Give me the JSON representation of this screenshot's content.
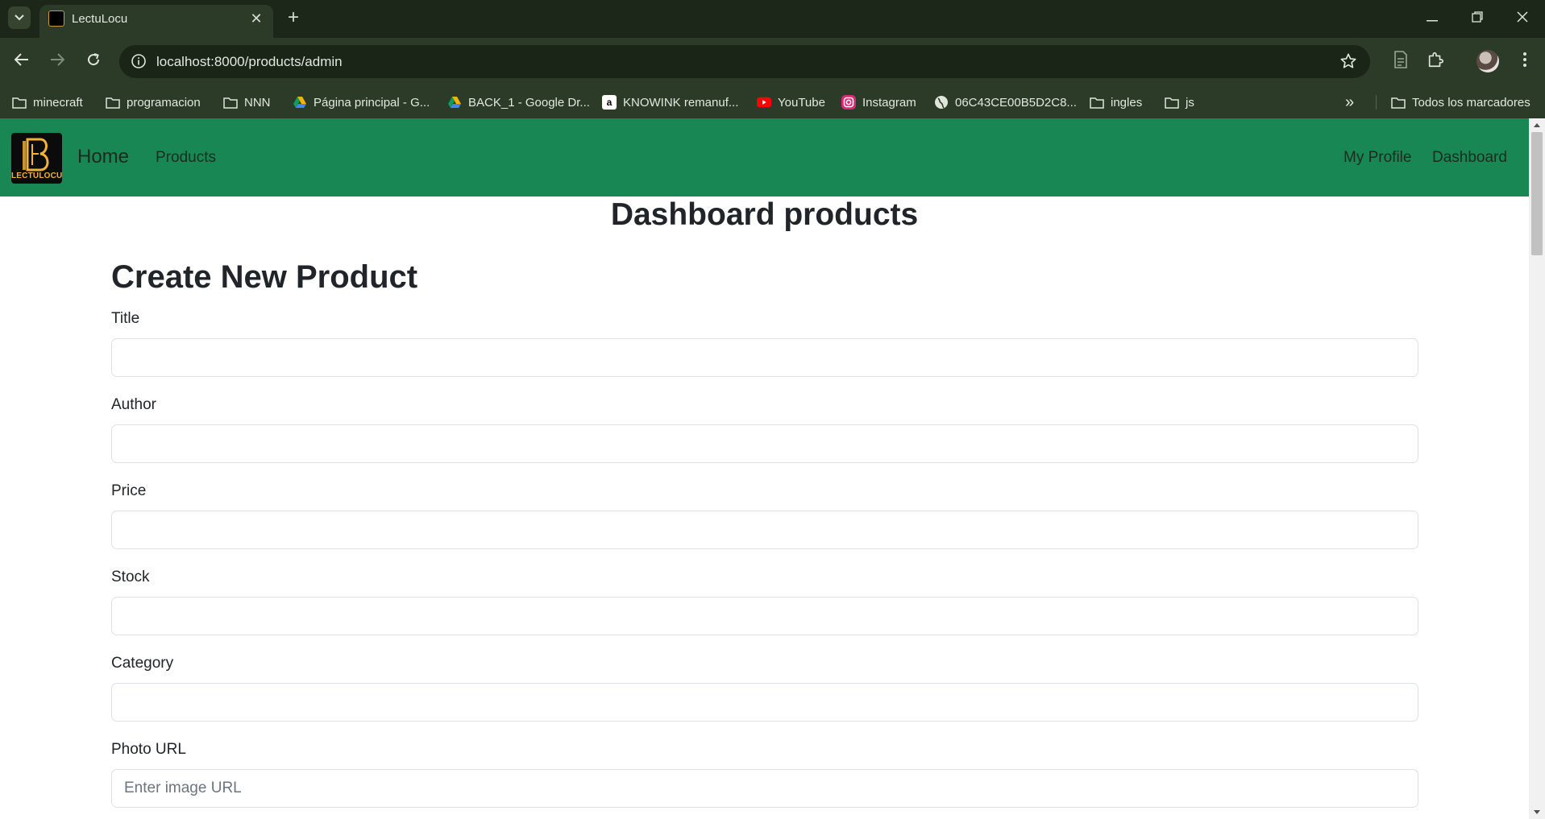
{
  "browser": {
    "tab": {
      "title": "LectuLocu",
      "favicon": "lectulocu-logo",
      "close": "✕"
    },
    "new_tab": "+",
    "window_controls": {
      "minimize": "—",
      "restore": "❐",
      "close": "✕"
    },
    "address": {
      "url": "localhost:8000/products/admin"
    },
    "bookmarks": [
      {
        "label": "minecraft",
        "icon": "folder-icon"
      },
      {
        "label": "programacion",
        "icon": "folder-icon"
      },
      {
        "label": "NNN",
        "icon": "folder-icon"
      },
      {
        "label": "Página principal - G...",
        "icon": "google-drive-icon"
      },
      {
        "label": "BACK_1 - Google Dr...",
        "icon": "google-drive-icon"
      },
      {
        "label": "KNOWINK remanuf...",
        "icon": "amazon-icon"
      },
      {
        "label": "YouTube",
        "icon": "youtube-icon"
      },
      {
        "label": "Instagram",
        "icon": "instagram-icon"
      },
      {
        "label": "06C43CE00B5D2C8...",
        "icon": "globe-icon"
      },
      {
        "label": "ingles",
        "icon": "folder-icon"
      },
      {
        "label": "js",
        "icon": "folder-icon"
      }
    ],
    "more_bookmarks": "»",
    "all_bookmarks": "Todos los marcadores"
  },
  "navbar": {
    "logo_text": "LECTULOCU",
    "home": "Home",
    "products": "Products",
    "my_profile": "My Profile",
    "dashboard": "Dashboard",
    "bg_color": "#198754"
  },
  "page": {
    "title": "Dashboard products",
    "form_title": "Create New Product",
    "fields": {
      "title": {
        "label": "Title",
        "value": "",
        "placeholder": ""
      },
      "author": {
        "label": "Author",
        "value": "",
        "placeholder": ""
      },
      "price": {
        "label": "Price",
        "value": "",
        "placeholder": ""
      },
      "stock": {
        "label": "Stock",
        "value": "",
        "placeholder": ""
      },
      "category": {
        "label": "Category",
        "value": "",
        "placeholder": ""
      },
      "photo_url": {
        "label": "Photo URL",
        "value": "",
        "placeholder": "Enter image URL"
      }
    }
  }
}
